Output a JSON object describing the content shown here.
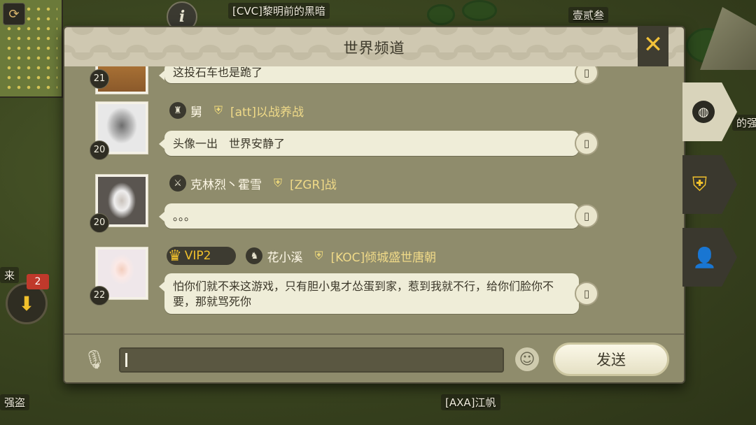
{
  "map": {
    "labels": [
      "[CVC]黎明前的黑暗",
      "壹贰叁",
      "强盗",
      "[AXA]江帆",
      "来",
      "的强盗"
    ],
    "info_icon": "i",
    "alert_badge": "2"
  },
  "panel": {
    "title": "世界频道",
    "close_icon": "✕"
  },
  "messages": [
    {
      "level": "21",
      "text": "这投石车也是跪了",
      "avatar": "warrior"
    },
    {
      "level": "20",
      "name": "舅",
      "guild": "[att]以战养战",
      "text": "头像一出　世界安静了",
      "avatar": "portrait-bw"
    },
    {
      "level": "20",
      "name": "克林烈丶霍雪",
      "guild": "[ZGR]战",
      "text": "。。。",
      "avatar": "silver-hair"
    },
    {
      "level": "22",
      "vip": "VIP2",
      "name": "花小溪",
      "guild": "[KOC]倾城盛世唐朝",
      "text": "怕你们就不来这游戏，只有胆小鬼才怂蛋到家，惹到我就不行，给你们脸你不要，那就骂死你",
      "avatar": "girl-photo"
    }
  ],
  "footer": {
    "input_value": "",
    "send_label": "发送"
  },
  "side_tabs": [
    "world-channel",
    "alliance-channel",
    "private-chat"
  ],
  "colors": {
    "accent_gold": "#f1c12c",
    "bubble": "#efedd8",
    "panel": "#9b9778"
  }
}
